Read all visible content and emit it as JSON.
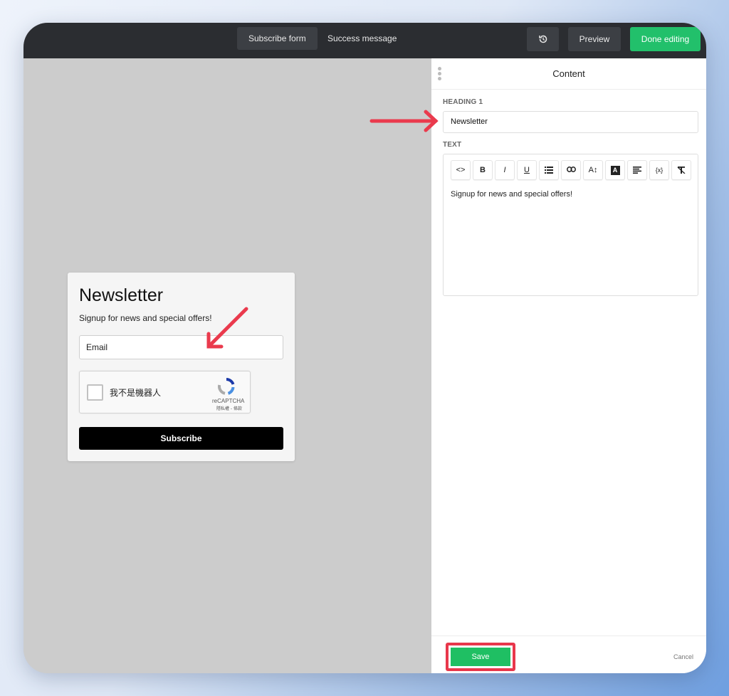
{
  "topbar": {
    "tabs": [
      {
        "label": "Subscribe form",
        "active": true
      },
      {
        "label": "Success message",
        "active": false
      }
    ],
    "history_icon": "history-icon",
    "preview_label": "Preview",
    "done_label": "Done editing",
    "done_color": "#22c06b"
  },
  "form_preview": {
    "title": "Newsletter",
    "text": "Signup for news and special offers!",
    "email_placeholder": "Email",
    "captcha_label": "我不是機器人",
    "captcha_brand": "reCAPTCHA",
    "captcha_links": "隱私權 - 條款",
    "subscribe_label": "Subscribe"
  },
  "panel": {
    "title": "Content",
    "heading_label": "HEADING 1",
    "heading_value": "Newsletter",
    "text_label": "TEXT",
    "toolbar": [
      {
        "icon": "code-icon",
        "glyph": "<>"
      },
      {
        "icon": "bold-icon",
        "glyph": "B"
      },
      {
        "icon": "italic-icon",
        "glyph": "I"
      },
      {
        "icon": "underline-icon",
        "glyph": "U"
      },
      {
        "icon": "list-icon",
        "glyph": ""
      },
      {
        "icon": "link-icon",
        "glyph": ""
      },
      {
        "icon": "font-size-icon",
        "glyph": "A↕"
      },
      {
        "icon": "text-color-icon",
        "glyph": "A"
      },
      {
        "icon": "align-icon",
        "glyph": ""
      },
      {
        "icon": "variable-icon",
        "glyph": "{x}"
      },
      {
        "icon": "clear-format-icon",
        "glyph": ""
      }
    ],
    "text_value": "Signup for news and special offers!",
    "save_label": "Save",
    "cancel_label": "Cancel",
    "save_color": "#1fbf63",
    "highlight_color": "#e8374b"
  }
}
